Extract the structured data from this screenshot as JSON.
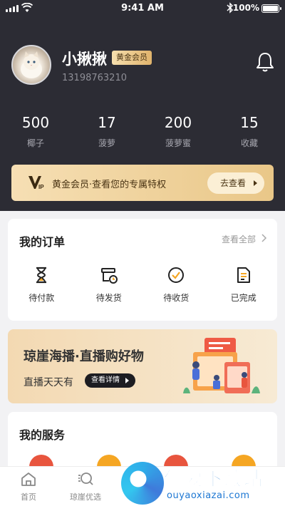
{
  "status_bar": {
    "time": "9:41 AM",
    "battery": "100%",
    "battery_level": 1.0
  },
  "profile": {
    "name": "小揪揪",
    "badge": "黄金会员",
    "phone": "13198763210"
  },
  "stats": [
    {
      "value": "500",
      "label": "椰子"
    },
    {
      "value": "17",
      "label": "菠萝"
    },
    {
      "value": "200",
      "label": "菠萝蜜"
    },
    {
      "value": "15",
      "label": "收藏"
    }
  ],
  "vip_bar": {
    "text": "黄金会员·查看您的专属特权",
    "button": "去查看"
  },
  "orders": {
    "title": "我的订单",
    "view_all": "查看全部",
    "items": [
      {
        "label": "待付款",
        "icon": "hourglass-icon"
      },
      {
        "label": "待发货",
        "icon": "shipping-box-icon"
      },
      {
        "label": "待收货",
        "icon": "check-circle-icon"
      },
      {
        "label": "已完成",
        "icon": "document-icon"
      }
    ]
  },
  "banner": {
    "title": "琼崖海播·直播购好物",
    "subtitle": "直播天天有",
    "button": "查看详情"
  },
  "services": {
    "title": "我的服务",
    "icon_colors": [
      "#e8553e",
      "#f5a623",
      "#e8553e",
      "#f5a623"
    ]
  },
  "tabbar": {
    "items": [
      {
        "label": "首页",
        "icon": "home-icon"
      },
      {
        "label": "琼崖优选",
        "icon": "search-icon"
      }
    ]
  },
  "watermark": {
    "title": "偶要下载站",
    "url": "ouyaoxiazai.com"
  },
  "colors": {
    "header_bg": "#2c2c34",
    "gold": "#e9c788",
    "page_bg": "#f2f2f4"
  }
}
